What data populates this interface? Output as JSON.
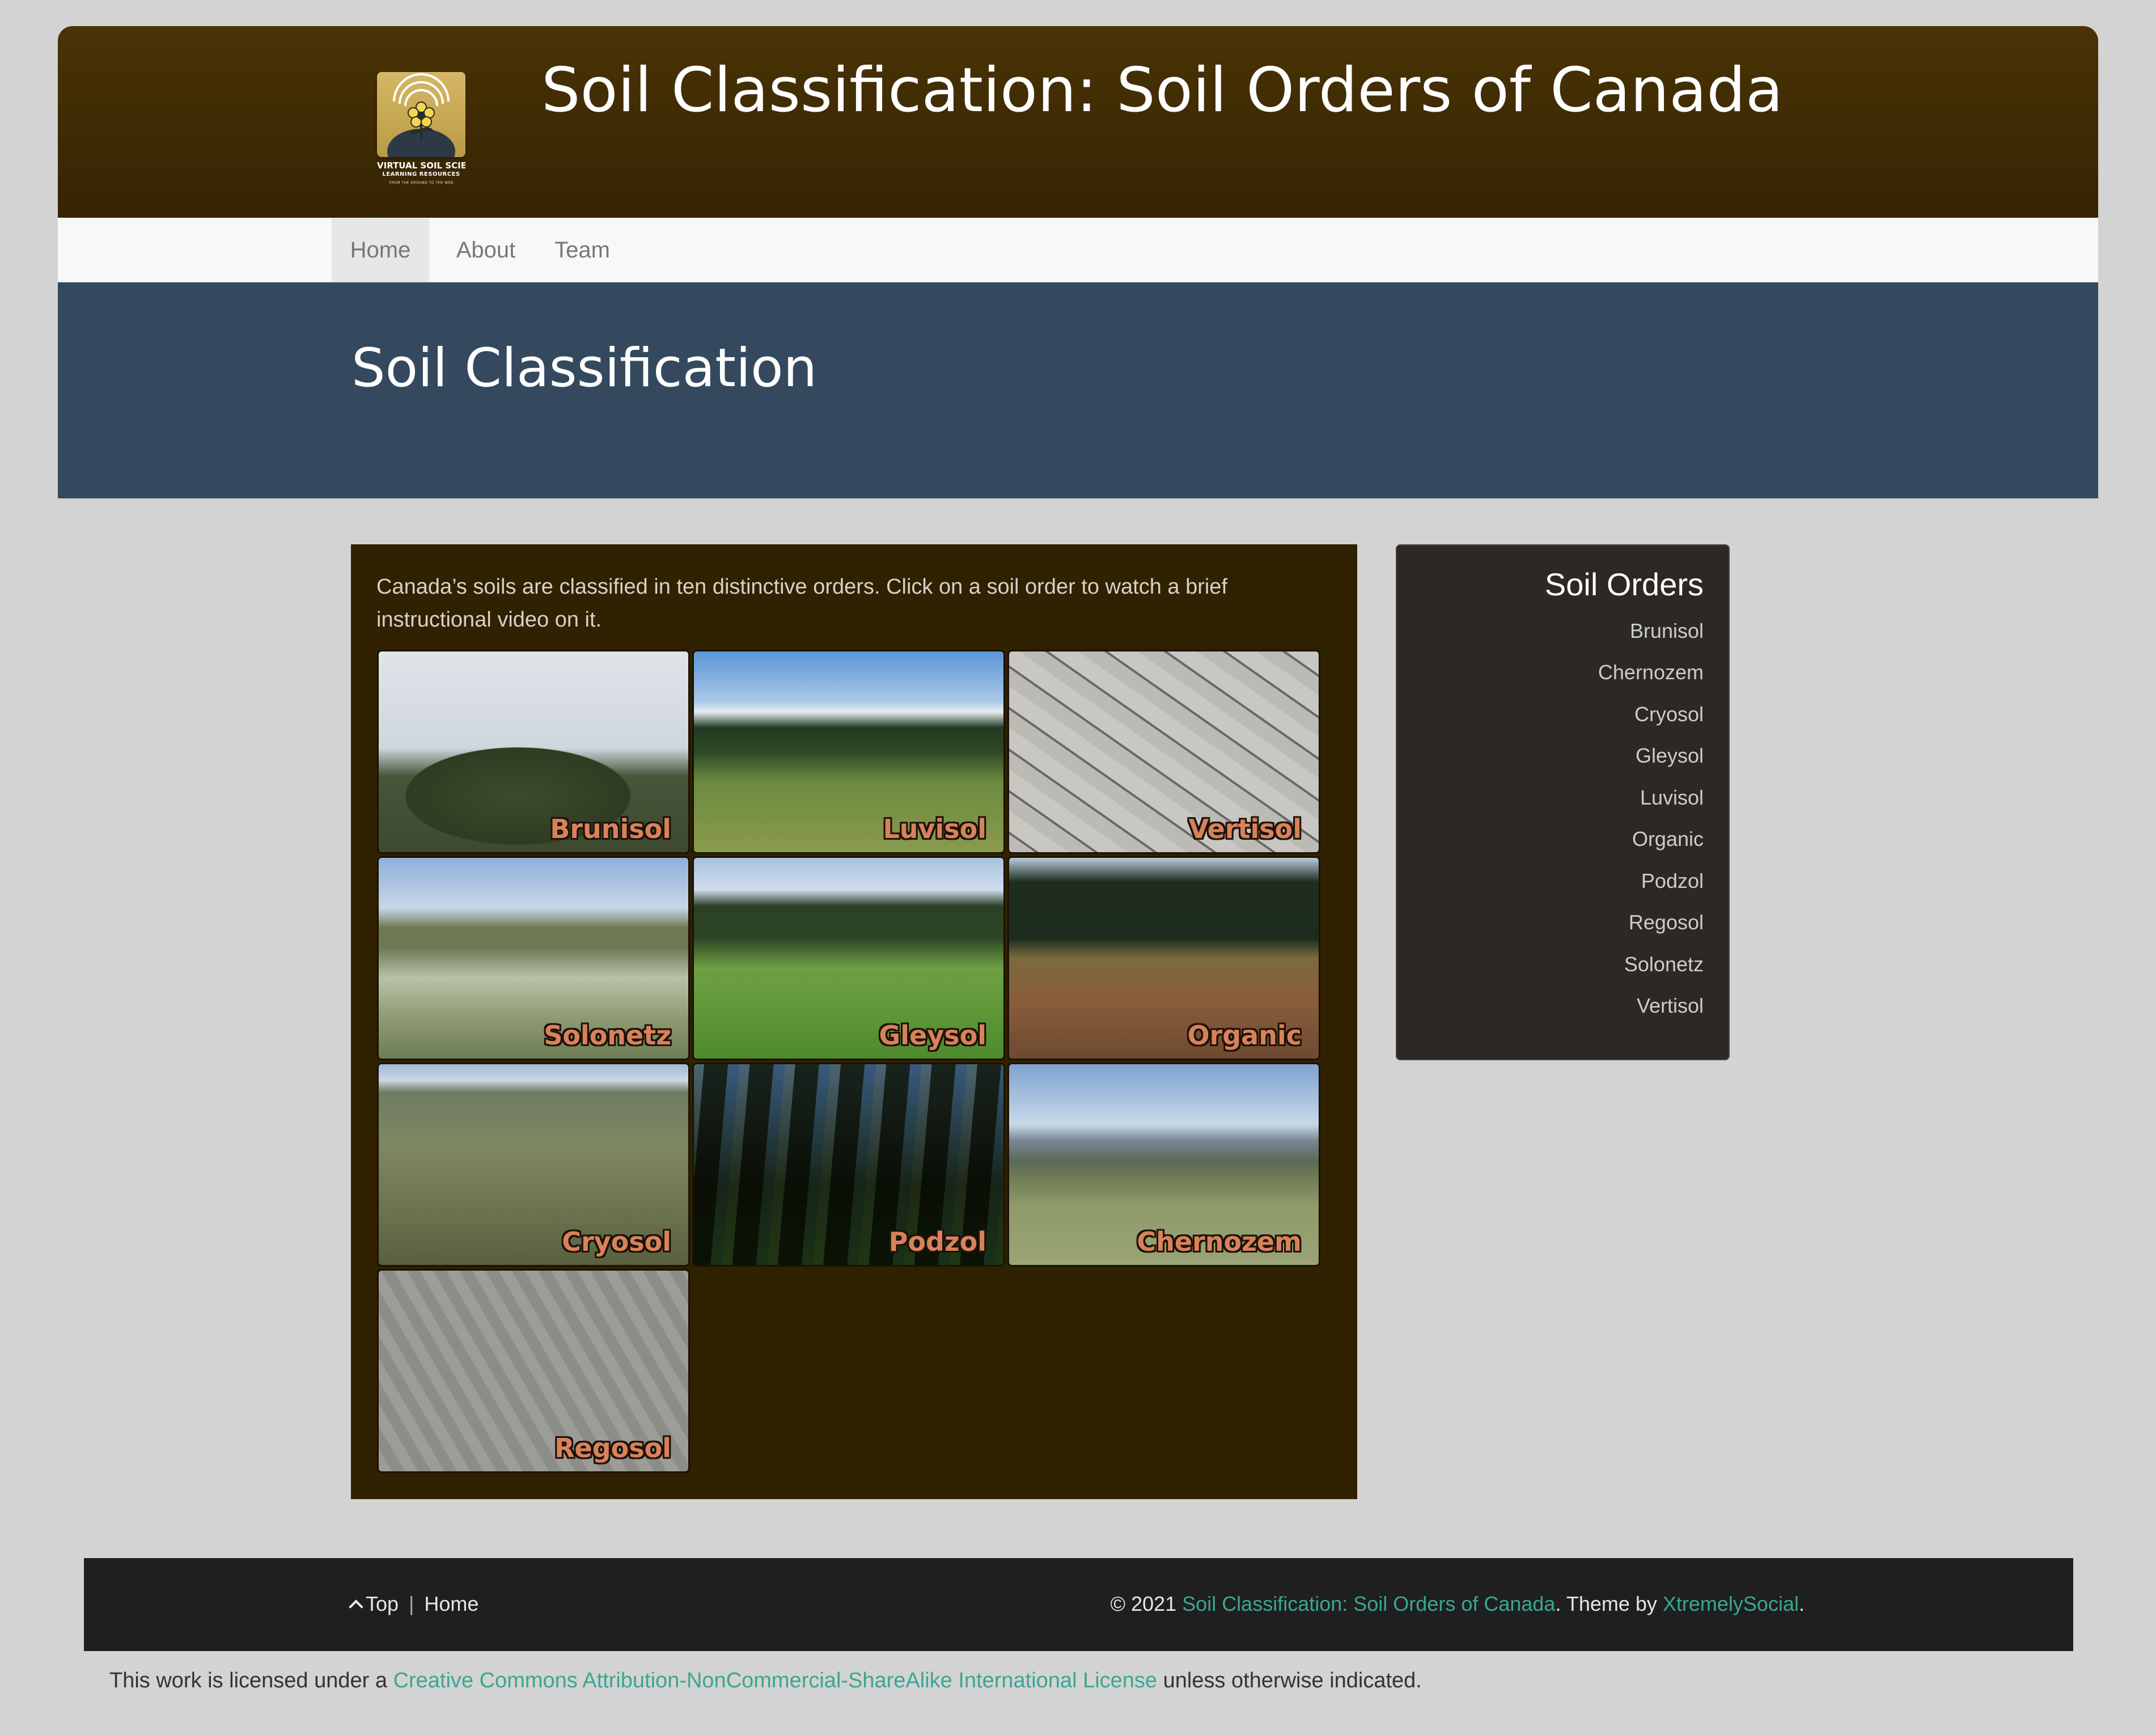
{
  "header": {
    "logo": {
      "line1": "VIRTUAL SOIL SCIENCE",
      "line2": "LEARNING RESOURCES",
      "line3": "FROM THE GROUND TO THE WEB"
    },
    "site_title": "Soil Classification: Soil Orders of Canada"
  },
  "nav": {
    "items": [
      {
        "label": "Home",
        "active": true
      },
      {
        "label": "About"
      },
      {
        "label": "Team"
      }
    ]
  },
  "banner": {
    "title": "Soil Classification"
  },
  "main": {
    "intro": "Canada’s soils are classified in ten distinctive orders. Click on a soil order to watch a brief instructional video on it.",
    "tiles": [
      {
        "label": "Brunisol"
      },
      {
        "label": "Luvisol"
      },
      {
        "label": "Vertisol"
      },
      {
        "label": "Solonetz"
      },
      {
        "label": "Gleysol"
      },
      {
        "label": "Organic"
      },
      {
        "label": "Cryosol"
      },
      {
        "label": "Podzol"
      },
      {
        "label": "Chernozem"
      },
      {
        "label": "Regosol"
      }
    ]
  },
  "sidebar": {
    "title": "Soil Orders",
    "items": [
      "Brunisol",
      "Chernozem",
      "Cryosol",
      "Gleysol",
      "Luvisol",
      "Organic",
      "Podzol",
      "Regosol",
      "Solonetz",
      "Vertisol"
    ]
  },
  "footer": {
    "top_label": "Top",
    "top_icon": "chevron-up-icon",
    "separator": "|",
    "home_label": "Home",
    "copyright_prefix": "© 2021 ",
    "site_link": "Soil Classification: Soil Orders of Canada",
    "theme_prefix": ". Theme by ",
    "theme_link": "XtremelySocial",
    "period": "."
  },
  "license": {
    "prefix": "This work is licensed under a ",
    "link": "Creative Commons Attribution-NonCommercial-ShareAlike International License",
    "suffix": " unless otherwise indicated."
  },
  "colors": {
    "header_brown": "#4a3305",
    "banner_blue": "#34495e",
    "panel_brown": "#302101",
    "link_green": "#3aa791",
    "tile_label": "#d8825a"
  }
}
